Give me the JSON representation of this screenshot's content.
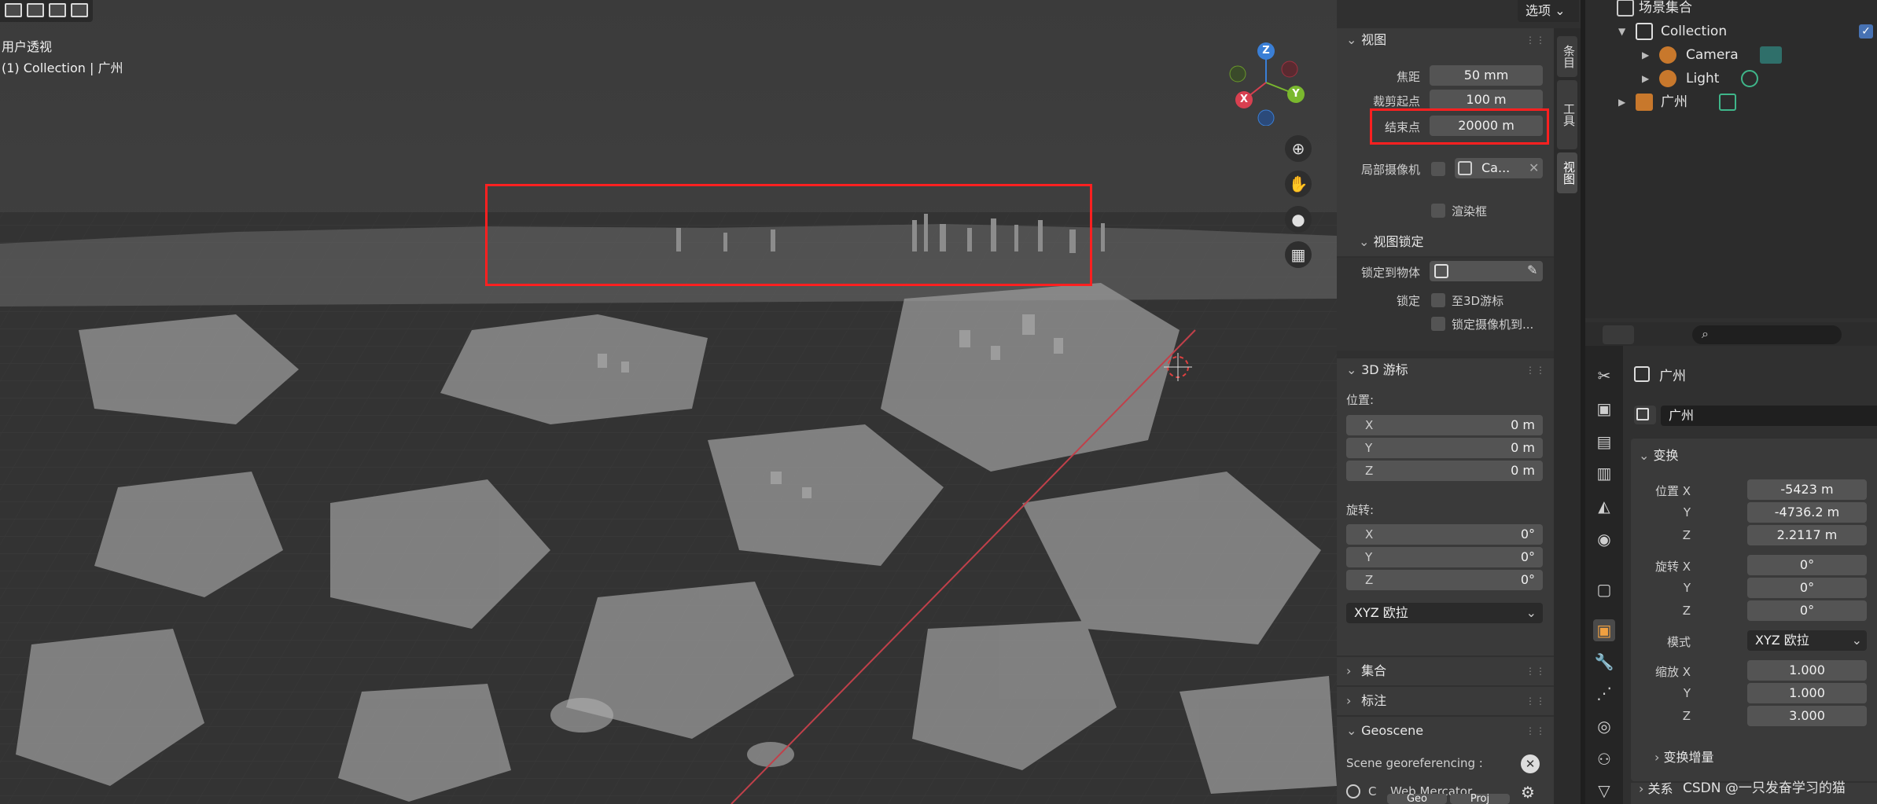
{
  "viewport": {
    "view_name": "用户透视",
    "collection_line": "(1) Collection | 广州",
    "options_label": "选项",
    "gizmo": {
      "x": "X",
      "y": "Y",
      "z": "Z"
    }
  },
  "npanel": {
    "view_section": {
      "title": "视图",
      "focal_label": "焦距",
      "focal_value": "50 mm",
      "clip_start_label": "裁剪起点",
      "clip_start_value": "100 m",
      "clip_end_label": "结束点",
      "clip_end_value": "20000 m",
      "local_camera_label": "局部摄像机",
      "local_camera_value": "Ca...",
      "render_region_label": "渲染框",
      "view_lock_title": "视图锁定",
      "lock_to_object_label": "锁定到物体",
      "lock_label": "锁定",
      "lock_3d_cursor": "至3D游标",
      "lock_camera": "锁定摄像机到..."
    },
    "cursor_section": {
      "title": "3D 游标",
      "location_label": "位置:",
      "loc": [
        {
          "axis": "X",
          "value": "0 m"
        },
        {
          "axis": "Y",
          "value": "0 m"
        },
        {
          "axis": "Z",
          "value": "0 m"
        }
      ],
      "rotation_label": "旋转:",
      "rot": [
        {
          "axis": "X",
          "value": "0°"
        },
        {
          "axis": "Y",
          "value": "0°"
        },
        {
          "axis": "Z",
          "value": "0°"
        }
      ],
      "mode_value": "XYZ 欧拉"
    },
    "collapsed": [
      "集合",
      "标注"
    ],
    "geoscene": {
      "title": "Geoscene",
      "georef_label": "Scene georeferencing :",
      "crs_prefix": "C",
      "crs_value": "Web Mercator",
      "btn1": "Geo",
      "btn2": "Proj"
    }
  },
  "sidetabs": [
    "条目",
    "工具",
    "视图"
  ],
  "outliner": {
    "scene_collection": "场景集合",
    "collection": "Collection",
    "camera": "Camera",
    "light": "Light",
    "object": "广州"
  },
  "properties": {
    "search_placeholder": "",
    "object_name": "广州",
    "datablock_name": "广州",
    "transform_title": "变换",
    "location_label": "位置 X",
    "loc": [
      {
        "axis": "X",
        "value": "-5423 m"
      },
      {
        "axis": "Y",
        "value": "-4736.2 m"
      },
      {
        "axis": "Z",
        "value": "2.2117 m"
      }
    ],
    "rotation_label": "旋转 X",
    "rot": [
      {
        "axis": "X",
        "value": "0°"
      },
      {
        "axis": "Y",
        "value": "0°"
      },
      {
        "axis": "Z",
        "value": "0°"
      }
    ],
    "mode_label": "模式",
    "mode_value": "XYZ 欧拉",
    "scale_label": "缩放 X",
    "scale": [
      {
        "axis": "X",
        "value": "1.000"
      },
      {
        "axis": "Y",
        "value": "1.000"
      },
      {
        "axis": "Z",
        "value": "3.000"
      }
    ],
    "delta_title": "变换增量",
    "relations_title": "关系"
  },
  "watermark": "CSDN @一只发奋学习的猫"
}
